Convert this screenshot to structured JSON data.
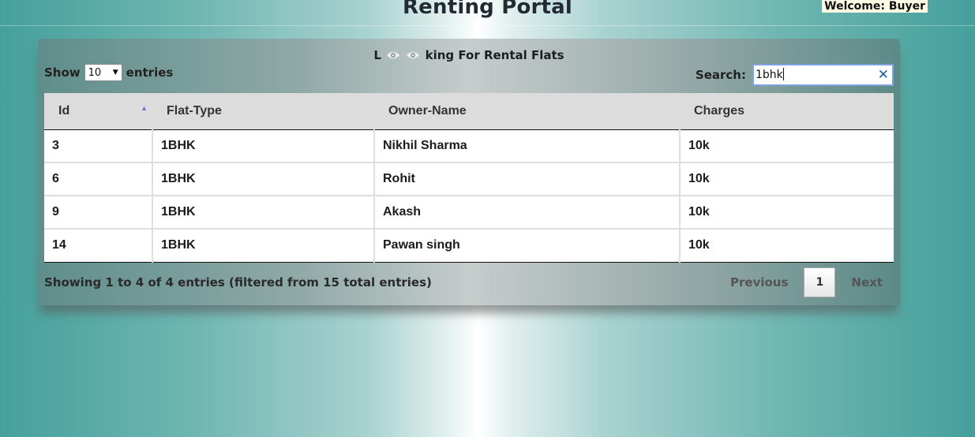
{
  "header": {
    "title": "Renting Portal",
    "welcome": "Welcome: Buyer"
  },
  "panel": {
    "title_prefix": "L",
    "title_suffix": "king For Rental Flats",
    "title_icons": [
      "eye-icon",
      "eye-icon"
    ]
  },
  "length_control": {
    "show_label": "Show",
    "selected": "10",
    "entries_label": "entries"
  },
  "search": {
    "label": "Search:",
    "value": "1bhk"
  },
  "table": {
    "columns": [
      "Id",
      "Flat-Type",
      "Owner-Name",
      "Charges"
    ],
    "sorted_column": "Id",
    "sort_direction": "ascending",
    "rows": [
      [
        "3",
        "1BHK",
        "Nikhil Sharma",
        "10k"
      ],
      [
        "6",
        "1BHK",
        "Rohit",
        "10k"
      ],
      [
        "9",
        "1BHK",
        "Akash",
        "10k"
      ],
      [
        "14",
        "1BHK",
        "Pawan singh",
        "10k"
      ]
    ]
  },
  "footer": {
    "info": "Showing 1 to 4 of 4 entries (filtered from 15 total entries)",
    "previous": "Previous",
    "current_page": "1",
    "next": "Next"
  }
}
